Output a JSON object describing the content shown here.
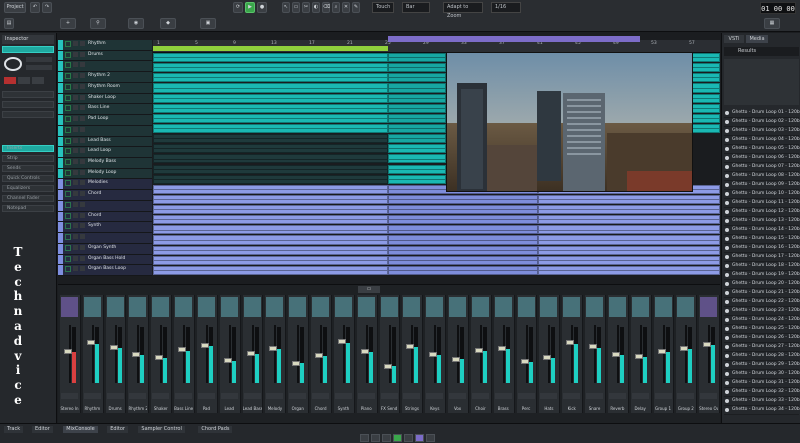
{
  "toolbar": {
    "project_label": "Project",
    "touch_label": "Touch",
    "snap_label": "Bar",
    "quantize_label": "Adapt to Zoom",
    "zoom_label": "1/16",
    "time_display": "01 00 00"
  },
  "inspector": {
    "title": "Inspector",
    "section_labels": [
      "Inserts",
      "Strip",
      "Sends",
      "Quick Controls",
      "Equalizers",
      "Channel Fader",
      "Notepad"
    ]
  },
  "watermark": "Technadvice",
  "tracks": [
    {
      "name": "Rhythm",
      "color": "#27c3bd"
    },
    {
      "name": "Drums",
      "color": "#27c3bd"
    },
    {
      "name": "",
      "color": "#27c3bd"
    },
    {
      "name": "Rhythm 2",
      "color": "#27c3bd"
    },
    {
      "name": "Rhythm Room",
      "color": "#27c3bd"
    },
    {
      "name": "Shaker Loop",
      "color": "#27c3bd"
    },
    {
      "name": "Bass Line",
      "color": "#27c3bd"
    },
    {
      "name": "Pad Loop",
      "color": "#27c3bd"
    },
    {
      "name": "",
      "color": "#27c3bd"
    },
    {
      "name": "Lead Bass",
      "color": "#27c3bd"
    },
    {
      "name": "Lead Loop",
      "color": "#27c3bd"
    },
    {
      "name": "Melody Bass",
      "color": "#27c3bd"
    },
    {
      "name": "Melody Loop",
      "color": "#27c3bd"
    },
    {
      "name": "Melodies",
      "color": "#7f8fe0"
    },
    {
      "name": "Chord",
      "color": "#7f8fe0"
    },
    {
      "name": "",
      "color": "#7f8fe0"
    },
    {
      "name": "Chord",
      "color": "#7f8fe0"
    },
    {
      "name": "Synth",
      "color": "#7f8fe0"
    },
    {
      "name": "",
      "color": "#7f8fe0"
    },
    {
      "name": "Organ Synth",
      "color": "#7f8fe0"
    },
    {
      "name": "Organ Bass Hold",
      "color": "#7f8fe0"
    },
    {
      "name": "Organ Bass Loop",
      "color": "#7f8fe0"
    }
  ],
  "ruler_marks": [
    "1",
    "5",
    "9",
    "13",
    "17",
    "21",
    "25",
    "29",
    "33",
    "37",
    "41",
    "45",
    "49",
    "53",
    "57"
  ],
  "mediabay": {
    "title": "Media",
    "tab_vst": "VSTi",
    "search_label": "Results",
    "items": [
      "Ghetto - Drum Loop 01 - 120bpm",
      "Ghetto - Drum Loop 02 - 120bpm",
      "Ghetto - Drum Loop 03 - 120bpm",
      "Ghetto - Drum Loop 04 - 120bpm",
      "Ghetto - Drum Loop 05 - 120bpm",
      "Ghetto - Drum Loop 06 - 120bpm",
      "Ghetto - Drum Loop 07 - 120bpm",
      "Ghetto - Drum Loop 08 - 120bpm",
      "Ghetto - Drum Loop 09 - 120bpm",
      "Ghetto - Drum Loop 10 - 120bpm",
      "Ghetto - Drum Loop 11 - 120bpm",
      "Ghetto - Drum Loop 12 - 120bpm",
      "Ghetto - Drum Loop 13 - 120bpm",
      "Ghetto - Drum Loop 14 - 120bpm",
      "Ghetto - Drum Loop 15 - 120bpm",
      "Ghetto - Drum Loop 16 - 120bpm",
      "Ghetto - Drum Loop 17 - 120bpm",
      "Ghetto - Drum Loop 18 - 120bpm",
      "Ghetto - Drum Loop 19 - 120bpm",
      "Ghetto - Drum Loop 20 - 120bpm",
      "Ghetto - Drum Loop 21 - 120bpm",
      "Ghetto - Drum Loop 22 - 120bpm",
      "Ghetto - Drum Loop 23 - 120bpm",
      "Ghetto - Drum Loop 24 - 120bpm",
      "Ghetto - Drum Loop 25 - 120bpm",
      "Ghetto - Drum Loop 26 - 120bpm",
      "Ghetto - Drum Loop 27 - 120bpm",
      "Ghetto - Drum Loop 28 - 120bpm",
      "Ghetto - Drum Loop 29 - 120bpm",
      "Ghetto - Drum Loop 30 - 120bpm",
      "Ghetto - Drum Loop 31 - 120bpm",
      "Ghetto - Drum Loop 32 - 120bpm",
      "Ghetto - Drum Loop 33 - 120bpm",
      "Ghetto - Drum Loop 34 - 120bpm"
    ]
  },
  "mixer": {
    "strips": [
      {
        "name": "Stereo In",
        "level": 0.55
      },
      {
        "name": "Rhythm",
        "level": 0.7
      },
      {
        "name": "Drums",
        "level": 0.62
      },
      {
        "name": "Rhythm 2",
        "level": 0.5
      },
      {
        "name": "Shaker",
        "level": 0.45
      },
      {
        "name": "Bass Line",
        "level": 0.58
      },
      {
        "name": "Pad",
        "level": 0.66
      },
      {
        "name": "Lead",
        "level": 0.4
      },
      {
        "name": "Lead Bass",
        "level": 0.52
      },
      {
        "name": "Melody",
        "level": 0.6
      },
      {
        "name": "Organ",
        "level": 0.35
      },
      {
        "name": "Chord",
        "level": 0.48
      },
      {
        "name": "Synth",
        "level": 0.72
      },
      {
        "name": "Piano",
        "level": 0.55
      },
      {
        "name": "FX Send",
        "level": 0.3
      },
      {
        "name": "Strings",
        "level": 0.64
      },
      {
        "name": "Keys",
        "level": 0.5
      },
      {
        "name": "Vox",
        "level": 0.42
      },
      {
        "name": "Choir",
        "level": 0.57
      },
      {
        "name": "Brass",
        "level": 0.6
      },
      {
        "name": "Perc",
        "level": 0.38
      },
      {
        "name": "Hats",
        "level": 0.44
      },
      {
        "name": "Kick",
        "level": 0.7
      },
      {
        "name": "Snare",
        "level": 0.63
      },
      {
        "name": "Reverb",
        "level": 0.5
      },
      {
        "name": "Delay",
        "level": 0.46
      },
      {
        "name": "Group 1",
        "level": 0.55
      },
      {
        "name": "Group 2",
        "level": 0.6
      },
      {
        "name": "Stereo Out",
        "level": 0.68
      }
    ]
  },
  "bottom": {
    "tabs": [
      "Track",
      "Editor",
      "MixConsole",
      "Editor",
      "Sampler Control",
      "Chord Pads"
    ]
  }
}
